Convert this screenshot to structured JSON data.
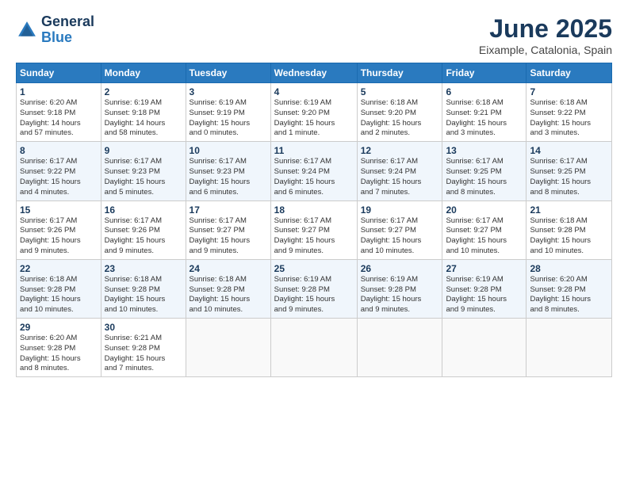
{
  "logo": {
    "line1": "General",
    "line2": "Blue"
  },
  "title": "June 2025",
  "subtitle": "Eixample, Catalonia, Spain",
  "headers": [
    "Sunday",
    "Monday",
    "Tuesday",
    "Wednesday",
    "Thursday",
    "Friday",
    "Saturday"
  ],
  "weeks": [
    [
      {
        "day": "1",
        "info": "Sunrise: 6:20 AM\nSunset: 9:18 PM\nDaylight: 14 hours\nand 57 minutes."
      },
      {
        "day": "2",
        "info": "Sunrise: 6:19 AM\nSunset: 9:18 PM\nDaylight: 14 hours\nand 58 minutes."
      },
      {
        "day": "3",
        "info": "Sunrise: 6:19 AM\nSunset: 9:19 PM\nDaylight: 15 hours\nand 0 minutes."
      },
      {
        "day": "4",
        "info": "Sunrise: 6:19 AM\nSunset: 9:20 PM\nDaylight: 15 hours\nand 1 minute."
      },
      {
        "day": "5",
        "info": "Sunrise: 6:18 AM\nSunset: 9:20 PM\nDaylight: 15 hours\nand 2 minutes."
      },
      {
        "day": "6",
        "info": "Sunrise: 6:18 AM\nSunset: 9:21 PM\nDaylight: 15 hours\nand 3 minutes."
      },
      {
        "day": "7",
        "info": "Sunrise: 6:18 AM\nSunset: 9:22 PM\nDaylight: 15 hours\nand 3 minutes."
      }
    ],
    [
      {
        "day": "8",
        "info": "Sunrise: 6:17 AM\nSunset: 9:22 PM\nDaylight: 15 hours\nand 4 minutes."
      },
      {
        "day": "9",
        "info": "Sunrise: 6:17 AM\nSunset: 9:23 PM\nDaylight: 15 hours\nand 5 minutes."
      },
      {
        "day": "10",
        "info": "Sunrise: 6:17 AM\nSunset: 9:23 PM\nDaylight: 15 hours\nand 6 minutes."
      },
      {
        "day": "11",
        "info": "Sunrise: 6:17 AM\nSunset: 9:24 PM\nDaylight: 15 hours\nand 6 minutes."
      },
      {
        "day": "12",
        "info": "Sunrise: 6:17 AM\nSunset: 9:24 PM\nDaylight: 15 hours\nand 7 minutes."
      },
      {
        "day": "13",
        "info": "Sunrise: 6:17 AM\nSunset: 9:25 PM\nDaylight: 15 hours\nand 8 minutes."
      },
      {
        "day": "14",
        "info": "Sunrise: 6:17 AM\nSunset: 9:25 PM\nDaylight: 15 hours\nand 8 minutes."
      }
    ],
    [
      {
        "day": "15",
        "info": "Sunrise: 6:17 AM\nSunset: 9:26 PM\nDaylight: 15 hours\nand 9 minutes."
      },
      {
        "day": "16",
        "info": "Sunrise: 6:17 AM\nSunset: 9:26 PM\nDaylight: 15 hours\nand 9 minutes."
      },
      {
        "day": "17",
        "info": "Sunrise: 6:17 AM\nSunset: 9:27 PM\nDaylight: 15 hours\nand 9 minutes."
      },
      {
        "day": "18",
        "info": "Sunrise: 6:17 AM\nSunset: 9:27 PM\nDaylight: 15 hours\nand 9 minutes."
      },
      {
        "day": "19",
        "info": "Sunrise: 6:17 AM\nSunset: 9:27 PM\nDaylight: 15 hours\nand 10 minutes."
      },
      {
        "day": "20",
        "info": "Sunrise: 6:17 AM\nSunset: 9:27 PM\nDaylight: 15 hours\nand 10 minutes."
      },
      {
        "day": "21",
        "info": "Sunrise: 6:18 AM\nSunset: 9:28 PM\nDaylight: 15 hours\nand 10 minutes."
      }
    ],
    [
      {
        "day": "22",
        "info": "Sunrise: 6:18 AM\nSunset: 9:28 PM\nDaylight: 15 hours\nand 10 minutes."
      },
      {
        "day": "23",
        "info": "Sunrise: 6:18 AM\nSunset: 9:28 PM\nDaylight: 15 hours\nand 10 minutes."
      },
      {
        "day": "24",
        "info": "Sunrise: 6:18 AM\nSunset: 9:28 PM\nDaylight: 15 hours\nand 10 minutes."
      },
      {
        "day": "25",
        "info": "Sunrise: 6:19 AM\nSunset: 9:28 PM\nDaylight: 15 hours\nand 9 minutes."
      },
      {
        "day": "26",
        "info": "Sunrise: 6:19 AM\nSunset: 9:28 PM\nDaylight: 15 hours\nand 9 minutes."
      },
      {
        "day": "27",
        "info": "Sunrise: 6:19 AM\nSunset: 9:28 PM\nDaylight: 15 hours\nand 9 minutes."
      },
      {
        "day": "28",
        "info": "Sunrise: 6:20 AM\nSunset: 9:28 PM\nDaylight: 15 hours\nand 8 minutes."
      }
    ],
    [
      {
        "day": "29",
        "info": "Sunrise: 6:20 AM\nSunset: 9:28 PM\nDaylight: 15 hours\nand 8 minutes."
      },
      {
        "day": "30",
        "info": "Sunrise: 6:21 AM\nSunset: 9:28 PM\nDaylight: 15 hours\nand 7 minutes."
      },
      {
        "day": "",
        "info": ""
      },
      {
        "day": "",
        "info": ""
      },
      {
        "day": "",
        "info": ""
      },
      {
        "day": "",
        "info": ""
      },
      {
        "day": "",
        "info": ""
      }
    ]
  ]
}
